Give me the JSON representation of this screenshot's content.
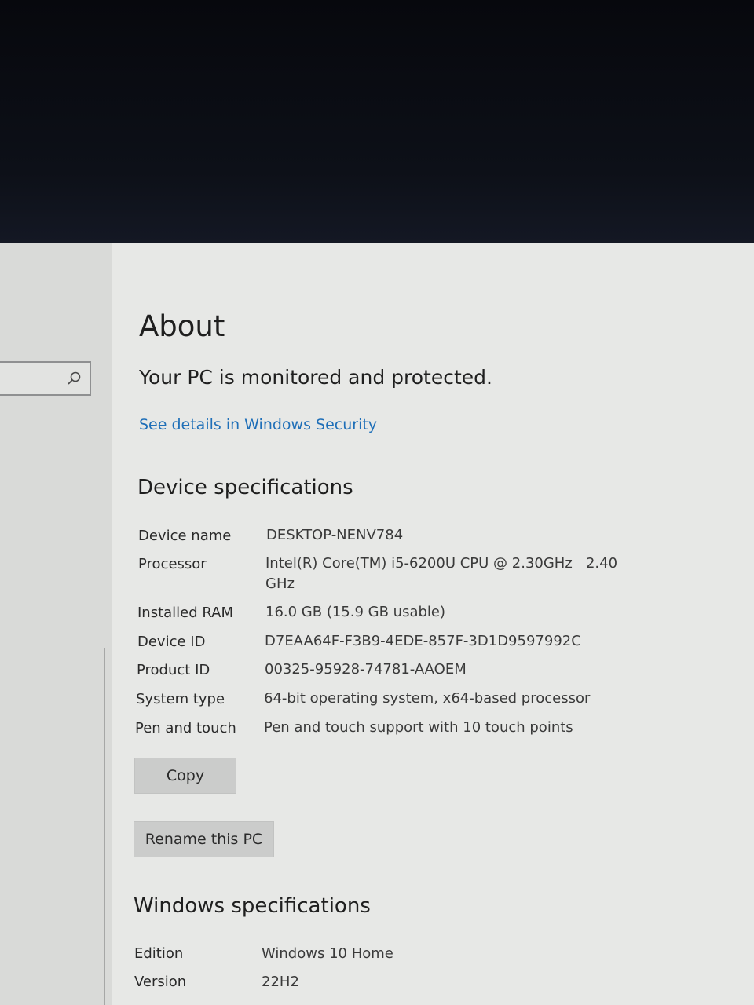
{
  "search": {
    "icon": "search-icon"
  },
  "about": {
    "title": "About",
    "status": "Your PC is monitored and protected.",
    "link": "See details in Windows Security"
  },
  "device_specs": {
    "heading": "Device specifications",
    "rows": [
      {
        "label": "Device name",
        "value": "DESKTOP-NENV784"
      },
      {
        "label": "Processor",
        "value": "Intel(R) Core(TM) i5-6200U CPU @ 2.30GHz   2.40",
        "value2": "GHz"
      },
      {
        "label": "Installed RAM",
        "value": "16.0 GB (15.9 GB usable)"
      },
      {
        "label": "Device ID",
        "value": "D7EAA64F-F3B9-4EDE-857F-3D1D9597992C"
      },
      {
        "label": "Product ID",
        "value": "00325-95928-74781-AAOEM"
      },
      {
        "label": "System type",
        "value": "64-bit operating system, x64-based processor"
      },
      {
        "label": "Pen and touch",
        "value": "Pen and touch support with 10 touch points"
      }
    ],
    "copy_label": "Copy",
    "rename_label": "Rename this PC"
  },
  "windows_specs": {
    "heading": "Windows specifications",
    "rows": [
      {
        "label": "Edition",
        "value": "Windows 10 Home"
      },
      {
        "label": "Version",
        "value": "22H2"
      }
    ]
  },
  "colors": {
    "link": "#1f6fb8",
    "background": "#e7e8e6",
    "button": "#cbcccb"
  }
}
